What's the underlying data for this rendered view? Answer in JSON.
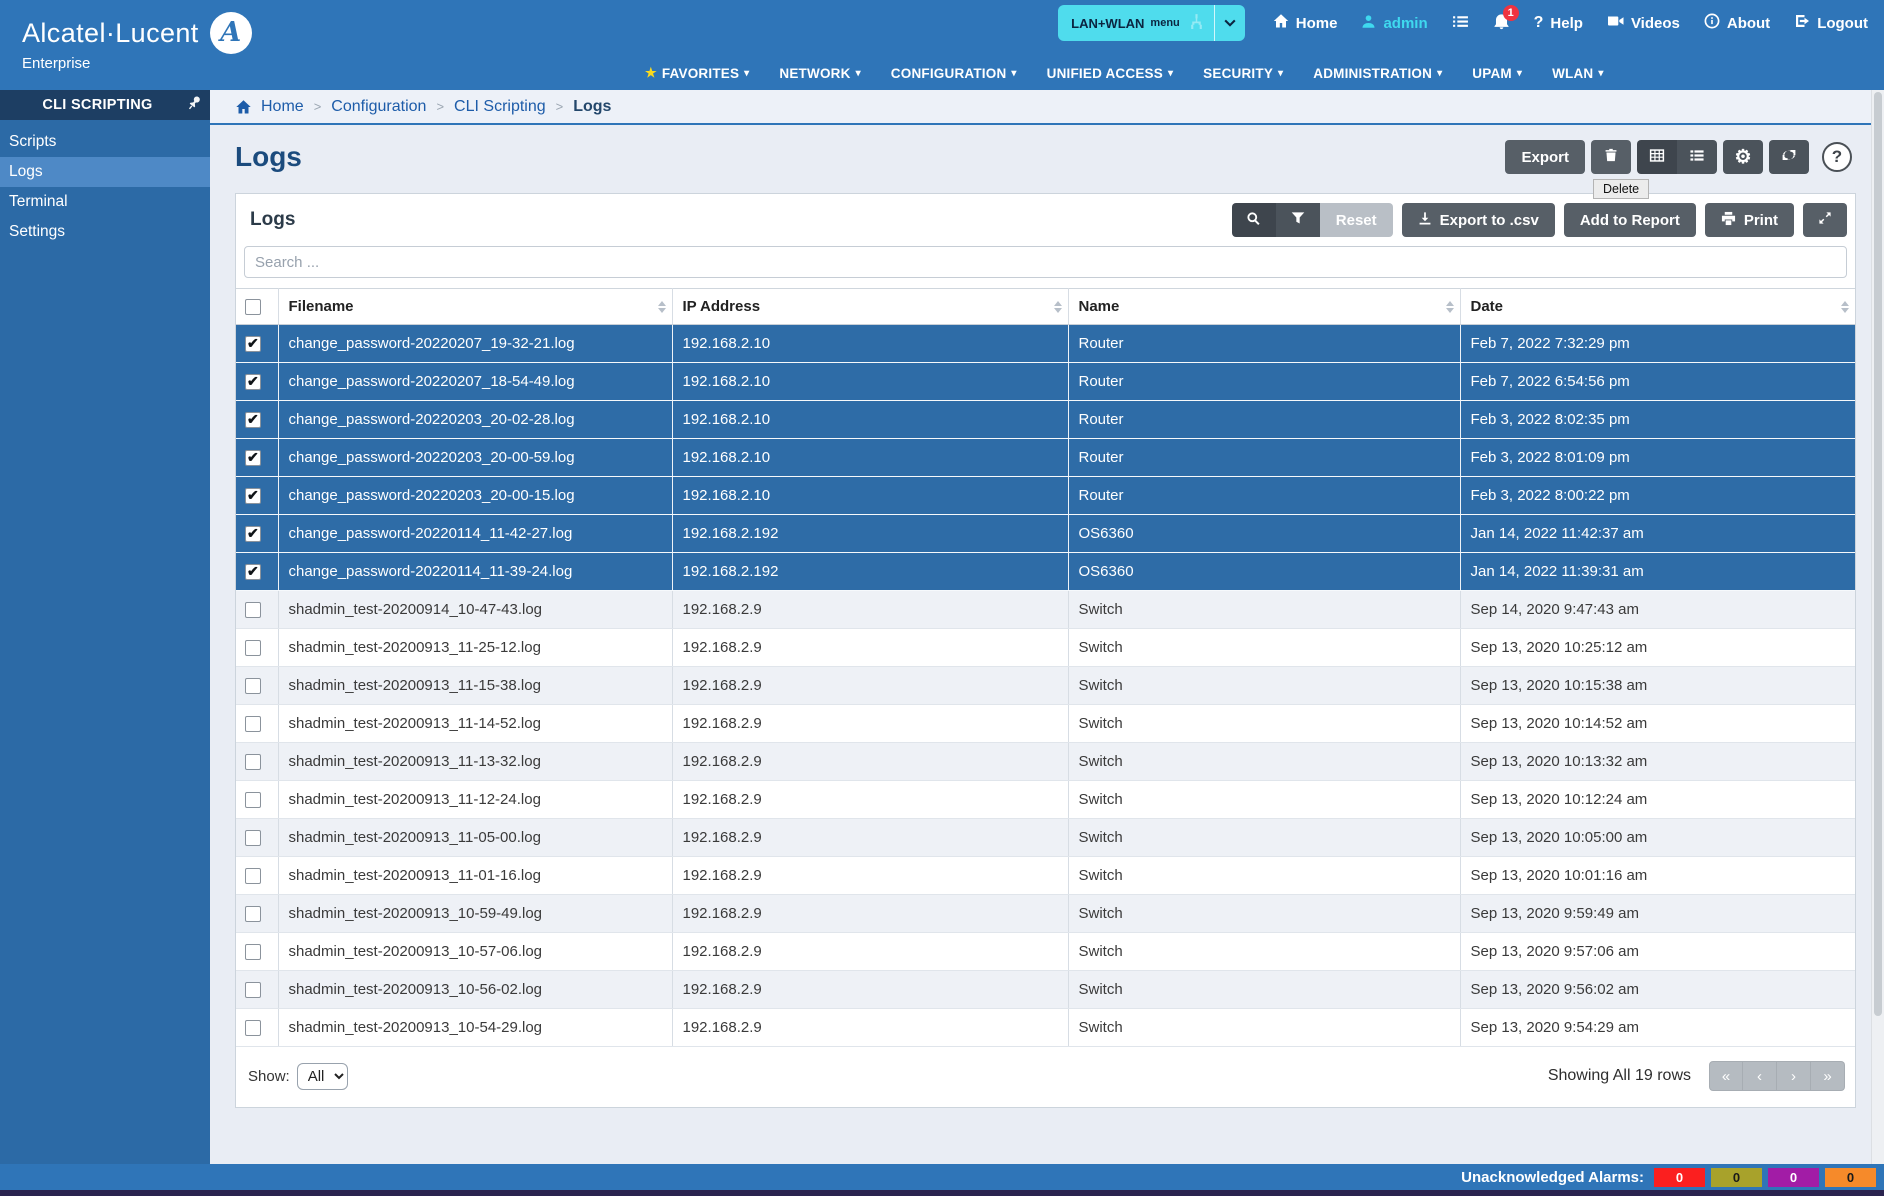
{
  "icons": {
    "caret": "▾",
    "star": "★",
    "gear": "⚙",
    "help_q": "?",
    "crumb_sep": ">",
    "pager": [
      "«",
      "‹",
      "›",
      "»"
    ]
  },
  "header": {
    "brand": {
      "name": "Alcatel·Lucent",
      "mark": "A",
      "sub": "Enterprise"
    },
    "menu_button": {
      "label": "LAN+WLAN",
      "sub": "menu"
    },
    "bell_badge": "1",
    "links": {
      "home": "Home",
      "user": "admin",
      "help": "Help",
      "videos": "Videos",
      "about": "About",
      "logout": "Logout"
    },
    "nav": [
      {
        "label": "FAVORITES",
        "star": true
      },
      {
        "label": "NETWORK"
      },
      {
        "label": "CONFIGURATION"
      },
      {
        "label": "UNIFIED ACCESS"
      },
      {
        "label": "SECURITY"
      },
      {
        "label": "ADMINISTRATION"
      },
      {
        "label": "UPAM"
      },
      {
        "label": "WLAN"
      }
    ]
  },
  "sidebar": {
    "title": "CLI SCRIPTING",
    "items": [
      {
        "label": "Scripts",
        "active": false
      },
      {
        "label": "Logs",
        "active": true
      },
      {
        "label": "Terminal",
        "active": false
      },
      {
        "label": "Settings",
        "active": false
      }
    ]
  },
  "breadcrumb": {
    "items": [
      "Home",
      "Configuration",
      "CLI Scripting",
      "Logs"
    ]
  },
  "page": {
    "title": "Logs"
  },
  "toolbar": {
    "export_label": "Export",
    "tooltip": "Delete"
  },
  "panel": {
    "title": "Logs",
    "buttons": {
      "reset": "Reset",
      "export_csv": "Export to .csv",
      "add_report": "Add to Report",
      "print": "Print"
    },
    "search_placeholder": "Search ...",
    "table": {
      "columns": [
        "Filename",
        "IP Address",
        "Name",
        "Date"
      ],
      "rows": [
        {
          "filename": "change_password-20220207_19-32-21.log",
          "ip": "192.168.2.10",
          "name": "Router",
          "date": "Feb 7, 2022 7:32:29 pm",
          "selected": true
        },
        {
          "filename": "change_password-20220207_18-54-49.log",
          "ip": "192.168.2.10",
          "name": "Router",
          "date": "Feb 7, 2022 6:54:56 pm",
          "selected": true
        },
        {
          "filename": "change_password-20220203_20-02-28.log",
          "ip": "192.168.2.10",
          "name": "Router",
          "date": "Feb 3, 2022 8:02:35 pm",
          "selected": true
        },
        {
          "filename": "change_password-20220203_20-00-59.log",
          "ip": "192.168.2.10",
          "name": "Router",
          "date": "Feb 3, 2022 8:01:09 pm",
          "selected": true
        },
        {
          "filename": "change_password-20220203_20-00-15.log",
          "ip": "192.168.2.10",
          "name": "Router",
          "date": "Feb 3, 2022 8:00:22 pm",
          "selected": true
        },
        {
          "filename": "change_password-20220114_11-42-27.log",
          "ip": "192.168.2.192",
          "name": "OS6360",
          "date": "Jan 14, 2022 11:42:37 am",
          "selected": true
        },
        {
          "filename": "change_password-20220114_11-39-24.log",
          "ip": "192.168.2.192",
          "name": "OS6360",
          "date": "Jan 14, 2022 11:39:31 am",
          "selected": true
        },
        {
          "filename": "shadmin_test-20200914_10-47-43.log",
          "ip": "192.168.2.9",
          "name": "Switch",
          "date": "Sep 14, 2020 9:47:43 am",
          "selected": false
        },
        {
          "filename": "shadmin_test-20200913_11-25-12.log",
          "ip": "192.168.2.9",
          "name": "Switch",
          "date": "Sep 13, 2020 10:25:12 am",
          "selected": false
        },
        {
          "filename": "shadmin_test-20200913_11-15-38.log",
          "ip": "192.168.2.9",
          "name": "Switch",
          "date": "Sep 13, 2020 10:15:38 am",
          "selected": false
        },
        {
          "filename": "shadmin_test-20200913_11-14-52.log",
          "ip": "192.168.2.9",
          "name": "Switch",
          "date": "Sep 13, 2020 10:14:52 am",
          "selected": false
        },
        {
          "filename": "shadmin_test-20200913_11-13-32.log",
          "ip": "192.168.2.9",
          "name": "Switch",
          "date": "Sep 13, 2020 10:13:32 am",
          "selected": false
        },
        {
          "filename": "shadmin_test-20200913_11-12-24.log",
          "ip": "192.168.2.9",
          "name": "Switch",
          "date": "Sep 13, 2020 10:12:24 am",
          "selected": false
        },
        {
          "filename": "shadmin_test-20200913_11-05-00.log",
          "ip": "192.168.2.9",
          "name": "Switch",
          "date": "Sep 13, 2020 10:05:00 am",
          "selected": false
        },
        {
          "filename": "shadmin_test-20200913_11-01-16.log",
          "ip": "192.168.2.9",
          "name": "Switch",
          "date": "Sep 13, 2020 10:01:16 am",
          "selected": false
        },
        {
          "filename": "shadmin_test-20200913_10-59-49.log",
          "ip": "192.168.2.9",
          "name": "Switch",
          "date": "Sep 13, 2020 9:59:49 am",
          "selected": false
        },
        {
          "filename": "shadmin_test-20200913_10-57-06.log",
          "ip": "192.168.2.9",
          "name": "Switch",
          "date": "Sep 13, 2020 9:57:06 am",
          "selected": false
        },
        {
          "filename": "shadmin_test-20200913_10-56-02.log",
          "ip": "192.168.2.9",
          "name": "Switch",
          "date": "Sep 13, 2020 9:56:02 am",
          "selected": false
        },
        {
          "filename": "shadmin_test-20200913_10-54-29.log",
          "ip": "192.168.2.9",
          "name": "Switch",
          "date": "Sep 13, 2020 9:54:29 am",
          "selected": false
        }
      ]
    },
    "footer": {
      "show_label": "Show:",
      "show_value": "All",
      "summary": "Showing All 19 rows"
    }
  },
  "statusbar": {
    "label": "Unacknowledged Alarms:",
    "badges": [
      {
        "value": "0",
        "bg": "#fb1f1f",
        "fg": "#ffffff"
      },
      {
        "value": "0",
        "bg": "#a8a22b",
        "fg": "#1a1a1a"
      },
      {
        "value": "0",
        "bg": "#a21ca6",
        "fg": "#ffffff"
      },
      {
        "value": "0",
        "bg": "#f68a2a",
        "fg": "#1a1a1a"
      }
    ]
  }
}
